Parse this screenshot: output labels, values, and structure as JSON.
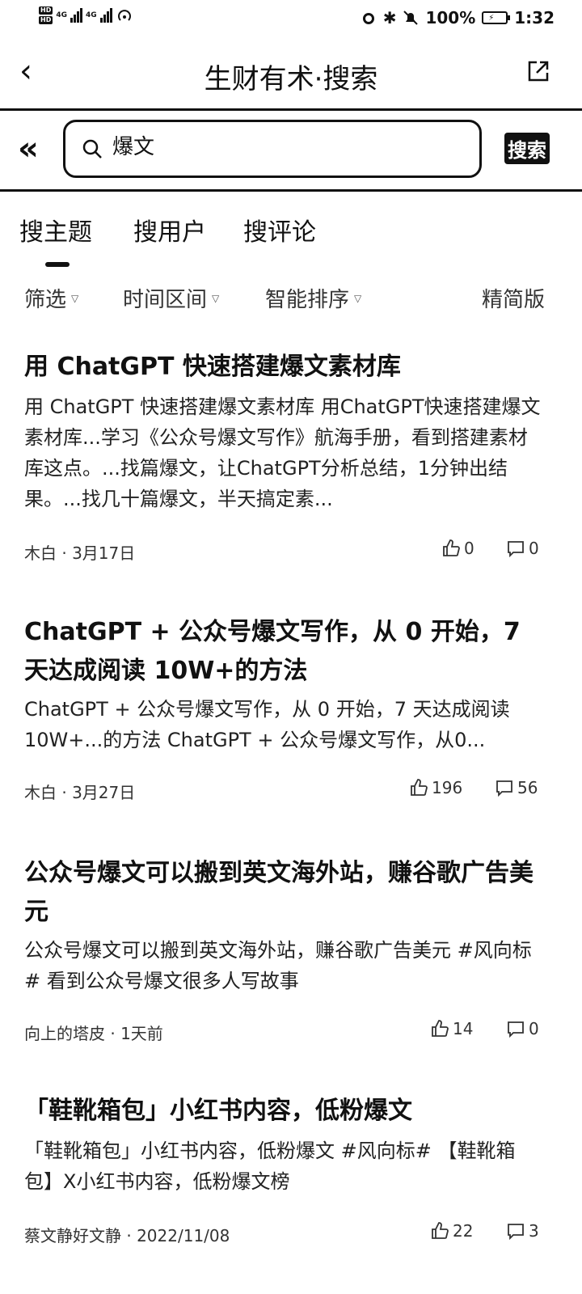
{
  "status_bar": {
    "hd1": "HD",
    "hd2": "HD",
    "net1": "4G",
    "net2": "4G",
    "battery": "100%",
    "time": "1:32"
  },
  "header": {
    "title": "生财有术·搜索"
  },
  "search": {
    "value": "爆文",
    "button": "搜索"
  },
  "tabs": [
    {
      "label": "搜主题"
    },
    {
      "label": "搜用户"
    },
    {
      "label": "搜评论"
    }
  ],
  "filters": {
    "filter": "筛选",
    "time_range": "时间区间",
    "sort": "智能排序",
    "mode": "精简版"
  },
  "results": [
    {
      "title": "用 ChatGPT 快速搭建爆文素材库",
      "snippet": "用 ChatGPT 快速搭建爆文素材库 用ChatGPT快速搭建爆文素材库...学习《公众号爆文写作》航海手册，看到搭建素材库这点。...找篇爆文，让ChatGPT分析总结，1分钟出结果。...找几十篇爆文，半天搞定素...",
      "author": "木白",
      "date": "3月17日",
      "likes": "0",
      "comments": "0"
    },
    {
      "title": "ChatGPT + 公众号爆文写作，从 0 开始，7 天达成阅读 10W+的方法",
      "snippet": "ChatGPT + 公众号爆文写作，从 0 开始，7 天达成阅读 10W+...的方法 ChatGPT + 公众号爆文写作，从0...",
      "author": "木白",
      "date": "3月27日",
      "likes": "196",
      "comments": "56"
    },
    {
      "title": "公众号爆文可以搬到英文海外站，赚谷歌广告美元",
      "snippet": "公众号爆文可以搬到英文海外站，赚谷歌广告美元 #风向标# 看到公众号爆文很多人写故事",
      "author": "向上的塔皮",
      "date": "1天前",
      "likes": "14",
      "comments": "0"
    },
    {
      "title": "「鞋靴箱包」小红书内容，低粉爆文",
      "snippet": "「鞋靴箱包」小红书内容，低粉爆文 #风向标# 【鞋靴箱包】X小红书内容，低粉爆文榜",
      "author": "蔡文静好文静",
      "date": "2022/11/08",
      "likes": "22",
      "comments": "3"
    }
  ]
}
